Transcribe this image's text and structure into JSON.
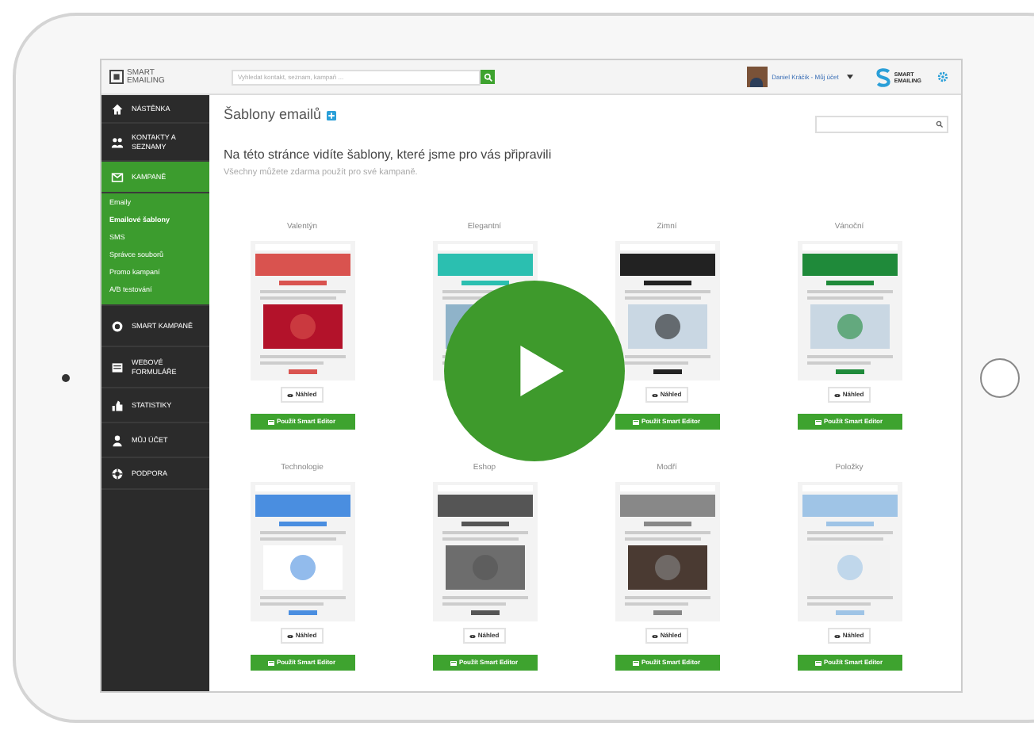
{
  "top_bar": {
    "logo_lines": [
      "SMART",
      "EMAILING"
    ],
    "search": {
      "placeholder": "Vyhledat kontakt, seznam, kampaň ..."
    },
    "user": "Daniel Kráčik - Můj účet",
    "brand_lines": [
      "SMART",
      "EMAILING"
    ]
  },
  "sidebar": {
    "items": [
      {
        "label": "NÁSTĚNKA",
        "selected": false
      },
      {
        "label": "KONTAKTY A SEZNAMY",
        "selected": false
      },
      {
        "label": "KAMPANĚ",
        "selected": true,
        "expanded": true,
        "children": [
          {
            "label": "Emaily",
            "selected": false
          },
          {
            "label": "Emailové šablony",
            "selected": true
          },
          {
            "label": "SMS",
            "selected": false
          },
          {
            "label": "Správce souborů",
            "selected": false
          },
          {
            "label": "Promo kampaní",
            "selected": false
          },
          {
            "label": "A/B testování",
            "selected": false
          }
        ]
      },
      {
        "label": "SMART KAMPANĚ",
        "selected": false
      },
      {
        "label": "WEBOVÉ FORMULÁŘE",
        "selected": false
      },
      {
        "label": "STATISTIKY",
        "selected": false
      },
      {
        "label": "MŮJ ÚČET",
        "selected": false
      },
      {
        "label": "PODPORA",
        "selected": false
      }
    ]
  },
  "page": {
    "title": "Šablony emailů",
    "heading": "Na této stránce vidíte šablony, které jsme pro vás připravili",
    "subheading": "Všechny můžete zdarma použít pro své kampaně.",
    "templates": [
      {
        "name": "Valentýn",
        "preview_button": "Náhled",
        "editor_button": "Použít Smart Editor"
      },
      {
        "name": "Elegantní"
      },
      {
        "name": "Zimní",
        "preview_button": "Náhled",
        "editor_button": "Použít Smart Editor"
      },
      {
        "name": "Vánoční",
        "preview_button": "Náhled",
        "editor_button": "Použít Smart Editor"
      },
      {
        "name": "Technologie",
        "preview_button": "Náhled",
        "editor_button": "Použít Smart Editor"
      },
      {
        "name": "Eshop",
        "preview_button": "Náhled",
        "editor_button": "Použít Smart Editor"
      },
      {
        "name": "Modří",
        "preview_button": "Náhled",
        "editor_button": "Použít Smart Editor"
      },
      {
        "name": "Položky",
        "preview_button": "Náhled",
        "editor_button": "Použít Smart Editor"
      }
    ]
  },
  "play_button": true
}
